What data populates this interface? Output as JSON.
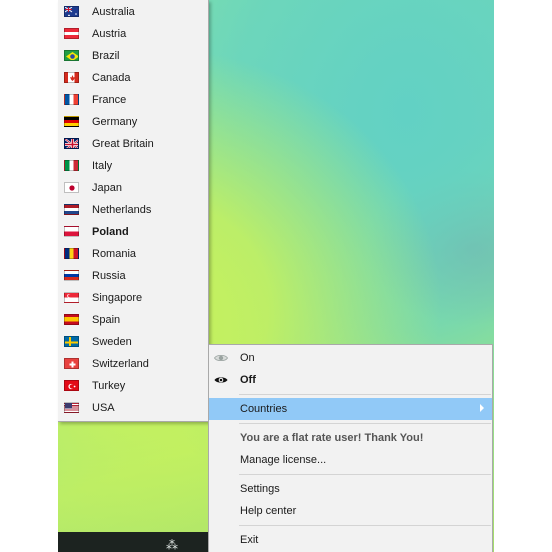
{
  "countries_submenu": {
    "items": [
      {
        "label": "Australia",
        "flag": "australia-flag-icon"
      },
      {
        "label": "Austria",
        "flag": "austria-flag-icon"
      },
      {
        "label": "Brazil",
        "flag": "brazil-flag-icon"
      },
      {
        "label": "Canada",
        "flag": "canada-flag-icon"
      },
      {
        "label": "France",
        "flag": "france-flag-icon"
      },
      {
        "label": "Germany",
        "flag": "germany-flag-icon"
      },
      {
        "label": "Great Britain",
        "flag": "great-britain-flag-icon"
      },
      {
        "label": "Italy",
        "flag": "italy-flag-icon"
      },
      {
        "label": "Japan",
        "flag": "japan-flag-icon"
      },
      {
        "label": "Netherlands",
        "flag": "netherlands-flag-icon"
      },
      {
        "label": "Poland",
        "flag": "poland-flag-icon",
        "selected": true
      },
      {
        "label": "Romania",
        "flag": "romania-flag-icon"
      },
      {
        "label": "Russia",
        "flag": "russia-flag-icon"
      },
      {
        "label": "Singapore",
        "flag": "singapore-flag-icon"
      },
      {
        "label": "Spain",
        "flag": "spain-flag-icon"
      },
      {
        "label": "Sweden",
        "flag": "sweden-flag-icon"
      },
      {
        "label": "Switzerland",
        "flag": "switzerland-flag-icon"
      },
      {
        "label": "Turkey",
        "flag": "turkey-flag-icon"
      },
      {
        "label": "USA",
        "flag": "usa-flag-icon"
      }
    ]
  },
  "tray_menu": {
    "on_label": "On",
    "off_label": "Off",
    "countries_label": "Countries",
    "status_text": "You are a flat rate user! Thank You!",
    "manage_license_label": "Manage license...",
    "settings_label": "Settings",
    "help_center_label": "Help center",
    "exit_label": "Exit"
  },
  "colors": {
    "menu_background": "#f2f2f2",
    "highlight": "#91c9f7"
  }
}
